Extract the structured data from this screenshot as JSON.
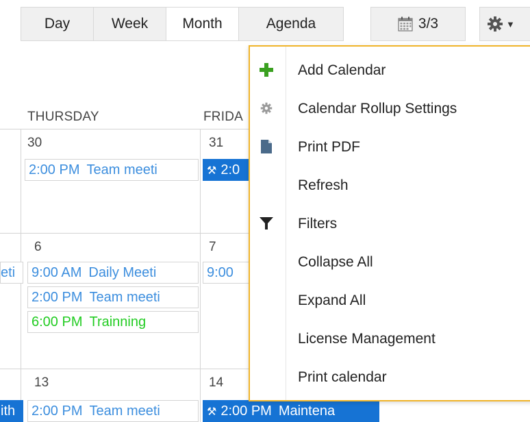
{
  "toolbar": {
    "tabs": [
      {
        "label": "Day",
        "active": false
      },
      {
        "label": "Week",
        "active": false
      },
      {
        "label": "Month",
        "active": true
      },
      {
        "label": "Agenda",
        "active": false
      }
    ],
    "calendar_count": "3/3",
    "calendar_count_icon": "calendar-icon",
    "settings_icon": "gear-icon"
  },
  "calendar": {
    "day_headers": [
      "THURSDAY",
      "FRIDA"
    ],
    "weeks": [
      {
        "thursday": {
          "day": "30",
          "events": [
            {
              "time": "2:00 PM",
              "title": "Team meeti",
              "color": "blue"
            }
          ]
        },
        "friday": {
          "day": "31",
          "events": [
            {
              "time": "2:0",
              "title": "",
              "color": "selected",
              "icon": "wrench-icon"
            }
          ]
        }
      },
      {
        "wednesday_fragment": {
          "title": "eti"
        },
        "thursday": {
          "day": "6",
          "events": [
            {
              "time": "9:00 AM",
              "title": "Daily Meeti",
              "color": "blue"
            },
            {
              "time": "2:00 PM",
              "title": "Team meeti",
              "color": "blue"
            },
            {
              "time": "6:00 PM",
              "title": "Trainning",
              "color": "green"
            }
          ]
        },
        "friday": {
          "day": "7",
          "events": [
            {
              "time": "9:00",
              "title": "",
              "color": "blue"
            }
          ]
        }
      },
      {
        "wednesday_fragment": {
          "title": "ith"
        },
        "thursday": {
          "day": "13",
          "events": [
            {
              "time": "2:00 PM",
              "title": "Team meeti",
              "color": "blue"
            }
          ]
        },
        "friday": {
          "day": "14",
          "events": [
            {
              "time": "2:00 PM",
              "title": "Maintena",
              "color": "selected",
              "icon": "wrench-icon"
            }
          ]
        }
      }
    ],
    "colors": {
      "event_blue": "#3c8ede",
      "event_green": "#22cc22",
      "event_selected": "#1673d4"
    }
  },
  "menu": {
    "border_color": "#f0b429",
    "items": [
      {
        "label": "Add Calendar",
        "icon": "plus-icon"
      },
      {
        "label": "Calendar Rollup Settings",
        "icon": "gear-small-icon"
      },
      {
        "label": "Print PDF",
        "icon": "document-icon"
      },
      {
        "label": "Refresh",
        "icon": ""
      },
      {
        "label": "Filters",
        "icon": "funnel-icon"
      },
      {
        "label": "Collapse All",
        "icon": ""
      },
      {
        "label": "Expand All",
        "icon": ""
      },
      {
        "label": "License Management",
        "icon": ""
      },
      {
        "label": "Print calendar",
        "icon": ""
      }
    ]
  }
}
